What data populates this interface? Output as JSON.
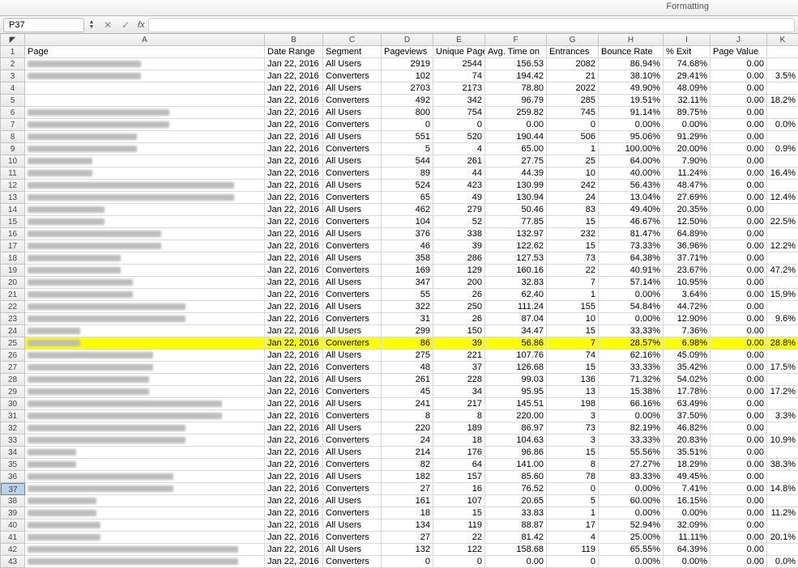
{
  "toolbar": {
    "formatting_label": "Formatting"
  },
  "formula_bar": {
    "cell_ref": "P37",
    "fx_label": "fx"
  },
  "columns": [
    "A",
    "B",
    "C",
    "D",
    "E",
    "F",
    "G",
    "H",
    "I",
    "J",
    "K"
  ],
  "headers": {
    "A": "Page",
    "B": "Date Range",
    "C": "Segment",
    "D": "Pageviews",
    "E": "Unique Page",
    "F": "Avg. Time on",
    "G": "Entrances",
    "H": "Bounce Rate",
    "I": "% Exit",
    "J": "Page Value",
    "K": ""
  },
  "highlight_row": 25,
  "selected_rowhead": 37,
  "rows": [
    {
      "n": 2,
      "blur": 140,
      "B": "Jan 22, 2016",
      "C": "All Users",
      "D": "2919",
      "E": "2544",
      "F": "156.53",
      "G": "2082",
      "H": "86.94%",
      "I": "74.68%",
      "J": "0.00",
      "K": ""
    },
    {
      "n": 3,
      "blur": 140,
      "B": "Jan 22, 2016",
      "C": "Converters",
      "D": "102",
      "E": "74",
      "F": "194.42",
      "G": "21",
      "H": "38.10%",
      "I": "29.41%",
      "J": "0.00",
      "K": "3.5%"
    },
    {
      "n": 4,
      "blur": 0,
      "B": "Jan 22, 2016",
      "C": "All Users",
      "D": "2703",
      "E": "2173",
      "F": "78.80",
      "G": "2022",
      "H": "49.90%",
      "I": "48.09%",
      "J": "0.00",
      "K": ""
    },
    {
      "n": 5,
      "blur": 0,
      "B": "Jan 22, 2016",
      "C": "Converters",
      "D": "492",
      "E": "342",
      "F": "96.79",
      "G": "285",
      "H": "19.51%",
      "I": "32.11%",
      "J": "0.00",
      "K": "18.2%"
    },
    {
      "n": 6,
      "blur": 175,
      "B": "Jan 22, 2016",
      "C": "All Users",
      "D": "800",
      "E": "754",
      "F": "259.82",
      "G": "745",
      "H": "91.14%",
      "I": "89.75%",
      "J": "0.00",
      "K": ""
    },
    {
      "n": 7,
      "blur": 175,
      "B": "Jan 22, 2016",
      "C": "Converters",
      "D": "0",
      "E": "0",
      "F": "0.00",
      "G": "0",
      "H": "0.00%",
      "I": "0.00%",
      "J": "0.00",
      "K": "0.0%"
    },
    {
      "n": 8,
      "blur": 135,
      "B": "Jan 22, 2016",
      "C": "All Users",
      "D": "551",
      "E": "520",
      "F": "190.44",
      "G": "506",
      "H": "95.06%",
      "I": "91.29%",
      "J": "0.00",
      "K": ""
    },
    {
      "n": 9,
      "blur": 135,
      "B": "Jan 22, 2016",
      "C": "Converters",
      "D": "5",
      "E": "4",
      "F": "65.00",
      "G": "1",
      "H": "100.00%",
      "I": "20.00%",
      "J": "0.00",
      "K": "0.9%"
    },
    {
      "n": 10,
      "blur": 80,
      "B": "Jan 22, 2016",
      "C": "All Users",
      "D": "544",
      "E": "261",
      "F": "27.75",
      "G": "25",
      "H": "64.00%",
      "I": "7.90%",
      "J": "0.00",
      "K": ""
    },
    {
      "n": 11,
      "blur": 80,
      "B": "Jan 22, 2016",
      "C": "Converters",
      "D": "89",
      "E": "44",
      "F": "44.39",
      "G": "10",
      "H": "40.00%",
      "I": "11.24%",
      "J": "0.00",
      "K": "16.4%"
    },
    {
      "n": 12,
      "blur": 255,
      "B": "Jan 22, 2016",
      "C": "All Users",
      "D": "524",
      "E": "423",
      "F": "130.99",
      "G": "242",
      "H": "56.43%",
      "I": "48.47%",
      "J": "0.00",
      "K": ""
    },
    {
      "n": 13,
      "blur": 255,
      "B": "Jan 22, 2016",
      "C": "Converters",
      "D": "65",
      "E": "49",
      "F": "130.94",
      "G": "24",
      "H": "13.04%",
      "I": "27.69%",
      "J": "0.00",
      "K": "12.4%"
    },
    {
      "n": 14,
      "blur": 95,
      "B": "Jan 22, 2016",
      "C": "All Users",
      "D": "462",
      "E": "279",
      "F": "50.46",
      "G": "83",
      "H": "49.40%",
      "I": "20.35%",
      "J": "0.00",
      "K": ""
    },
    {
      "n": 15,
      "blur": 95,
      "B": "Jan 22, 2016",
      "C": "Converters",
      "D": "104",
      "E": "52",
      "F": "77.85",
      "G": "15",
      "H": "46.67%",
      "I": "12.50%",
      "J": "0.00",
      "K": "22.5%"
    },
    {
      "n": 16,
      "blur": 165,
      "B": "Jan 22, 2016",
      "C": "All Users",
      "D": "376",
      "E": "338",
      "F": "132.97",
      "G": "232",
      "H": "81.47%",
      "I": "64.89%",
      "J": "0.00",
      "K": ""
    },
    {
      "n": 17,
      "blur": 165,
      "B": "Jan 22, 2016",
      "C": "Converters",
      "D": "46",
      "E": "39",
      "F": "122.62",
      "G": "15",
      "H": "73.33%",
      "I": "36.96%",
      "J": "0.00",
      "K": "12.2%"
    },
    {
      "n": 18,
      "blur": 115,
      "B": "Jan 22, 2016",
      "C": "All Users",
      "D": "358",
      "E": "286",
      "F": "127.53",
      "G": "73",
      "H": "64.38%",
      "I": "37.71%",
      "J": "0.00",
      "K": ""
    },
    {
      "n": 19,
      "blur": 115,
      "B": "Jan 22, 2016",
      "C": "Converters",
      "D": "169",
      "E": "129",
      "F": "160.16",
      "G": "22",
      "H": "40.91%",
      "I": "23.67%",
      "J": "0.00",
      "K": "47.2%"
    },
    {
      "n": 20,
      "blur": 130,
      "B": "Jan 22, 2016",
      "C": "All Users",
      "D": "347",
      "E": "200",
      "F": "32.83",
      "G": "7",
      "H": "57.14%",
      "I": "10.95%",
      "J": "0.00",
      "K": ""
    },
    {
      "n": 21,
      "blur": 130,
      "B": "Jan 22, 2016",
      "C": "Converters",
      "D": "55",
      "E": "26",
      "F": "62.40",
      "G": "1",
      "H": "0.00%",
      "I": "3.64%",
      "J": "0.00",
      "K": "15.9%"
    },
    {
      "n": 22,
      "blur": 195,
      "B": "Jan 22, 2016",
      "C": "All Users",
      "D": "322",
      "E": "250",
      "F": "111.24",
      "G": "155",
      "H": "54.84%",
      "I": "44.72%",
      "J": "0.00",
      "K": ""
    },
    {
      "n": 23,
      "blur": 195,
      "B": "Jan 22, 2016",
      "C": "Converters",
      "D": "31",
      "E": "26",
      "F": "87.04",
      "G": "10",
      "H": "0.00%",
      "I": "12.90%",
      "J": "0.00",
      "K": "9.6%"
    },
    {
      "n": 24,
      "blur": 65,
      "B": "Jan 22, 2016",
      "C": "All Users",
      "D": "299",
      "E": "150",
      "F": "34.47",
      "G": "15",
      "H": "33.33%",
      "I": "7.36%",
      "J": "0.00",
      "K": ""
    },
    {
      "n": 25,
      "blur": 65,
      "B": "Jan 22, 2016",
      "C": "Converters",
      "D": "86",
      "E": "39",
      "F": "56.86",
      "G": "7",
      "H": "28.57%",
      "I": "6.98%",
      "J": "0.00",
      "K": "28.8%"
    },
    {
      "n": 26,
      "blur": 155,
      "B": "Jan 22, 2016",
      "C": "All Users",
      "D": "275",
      "E": "221",
      "F": "107.76",
      "G": "74",
      "H": "62.16%",
      "I": "45.09%",
      "J": "0.00",
      "K": ""
    },
    {
      "n": 27,
      "blur": 155,
      "B": "Jan 22, 2016",
      "C": "Converters",
      "D": "48",
      "E": "37",
      "F": "126.68",
      "G": "15",
      "H": "33.33%",
      "I": "35.42%",
      "J": "0.00",
      "K": "17.5%"
    },
    {
      "n": 28,
      "blur": 150,
      "B": "Jan 22, 2016",
      "C": "All Users",
      "D": "261",
      "E": "228",
      "F": "99.03",
      "G": "136",
      "H": "71.32%",
      "I": "54.02%",
      "J": "0.00",
      "K": ""
    },
    {
      "n": 29,
      "blur": 150,
      "B": "Jan 22, 2016",
      "C": "Converters",
      "D": "45",
      "E": "34",
      "F": "95.95",
      "G": "13",
      "H": "15.38%",
      "I": "17.78%",
      "J": "0.00",
      "K": "17.2%"
    },
    {
      "n": 30,
      "blur": 240,
      "B": "Jan 22, 2016",
      "C": "All Users",
      "D": "241",
      "E": "217",
      "F": "145.51",
      "G": "198",
      "H": "66.16%",
      "I": "63.49%",
      "J": "0.00",
      "K": ""
    },
    {
      "n": 31,
      "blur": 240,
      "B": "Jan 22, 2016",
      "C": "Converters",
      "D": "8",
      "E": "8",
      "F": "220.00",
      "G": "3",
      "H": "0.00%",
      "I": "37.50%",
      "J": "0.00",
      "K": "3.3%"
    },
    {
      "n": 32,
      "blur": 195,
      "B": "Jan 22, 2016",
      "C": "All Users",
      "D": "220",
      "E": "189",
      "F": "86.97",
      "G": "73",
      "H": "82.19%",
      "I": "46.82%",
      "J": "0.00",
      "K": ""
    },
    {
      "n": 33,
      "blur": 195,
      "B": "Jan 22, 2016",
      "C": "Converters",
      "D": "24",
      "E": "18",
      "F": "104.63",
      "G": "3",
      "H": "33.33%",
      "I": "20.83%",
      "J": "0.00",
      "K": "10.9%"
    },
    {
      "n": 34,
      "blur": 60,
      "B": "Jan 22, 2016",
      "C": "All Users",
      "D": "214",
      "E": "176",
      "F": "96.86",
      "G": "15",
      "H": "55.56%",
      "I": "35.51%",
      "J": "0.00",
      "K": ""
    },
    {
      "n": 35,
      "blur": 60,
      "B": "Jan 22, 2016",
      "C": "Converters",
      "D": "82",
      "E": "64",
      "F": "141.00",
      "G": "8",
      "H": "27.27%",
      "I": "18.29%",
      "J": "0.00",
      "K": "38.3%"
    },
    {
      "n": 36,
      "blur": 180,
      "B": "Jan 22, 2016",
      "C": "All Users",
      "D": "182",
      "E": "157",
      "F": "85.60",
      "G": "78",
      "H": "83.33%",
      "I": "49.45%",
      "J": "0.00",
      "K": ""
    },
    {
      "n": 37,
      "blur": 180,
      "B": "Jan 22, 2016",
      "C": "Converters",
      "D": "27",
      "E": "16",
      "F": "76.52",
      "G": "0",
      "H": "0.00%",
      "I": "7.41%",
      "J": "0.00",
      "K": "14.8%"
    },
    {
      "n": 38,
      "blur": 85,
      "B": "Jan 22, 2016",
      "C": "All Users",
      "D": "161",
      "E": "107",
      "F": "20.65",
      "G": "5",
      "H": "60.00%",
      "I": "16.15%",
      "J": "0.00",
      "K": ""
    },
    {
      "n": 39,
      "blur": 85,
      "B": "Jan 22, 2016",
      "C": "Converters",
      "D": "18",
      "E": "15",
      "F": "33.83",
      "G": "1",
      "H": "0.00%",
      "I": "0.00%",
      "J": "0.00",
      "K": "11.2%"
    },
    {
      "n": 40,
      "blur": 90,
      "B": "Jan 22, 2016",
      "C": "All Users",
      "D": "134",
      "E": "119",
      "F": "88.87",
      "G": "17",
      "H": "52.94%",
      "I": "32.09%",
      "J": "0.00",
      "K": ""
    },
    {
      "n": 41,
      "blur": 90,
      "B": "Jan 22, 2016",
      "C": "Converters",
      "D": "27",
      "E": "22",
      "F": "81.42",
      "G": "4",
      "H": "25.00%",
      "I": "11.11%",
      "J": "0.00",
      "K": "20.1%"
    },
    {
      "n": 42,
      "blur": 260,
      "B": "Jan 22, 2016",
      "C": "All Users",
      "D": "132",
      "E": "122",
      "F": "158.68",
      "G": "119",
      "H": "65.55%",
      "I": "64.39%",
      "J": "0.00",
      "K": ""
    },
    {
      "n": 43,
      "blur": 260,
      "B": "Jan 22, 2016",
      "C": "Converters",
      "D": "0",
      "E": "0",
      "F": "0.00",
      "G": "0",
      "H": "0.00%",
      "I": "0.00%",
      "J": "0.00",
      "K": "0.0%"
    }
  ]
}
